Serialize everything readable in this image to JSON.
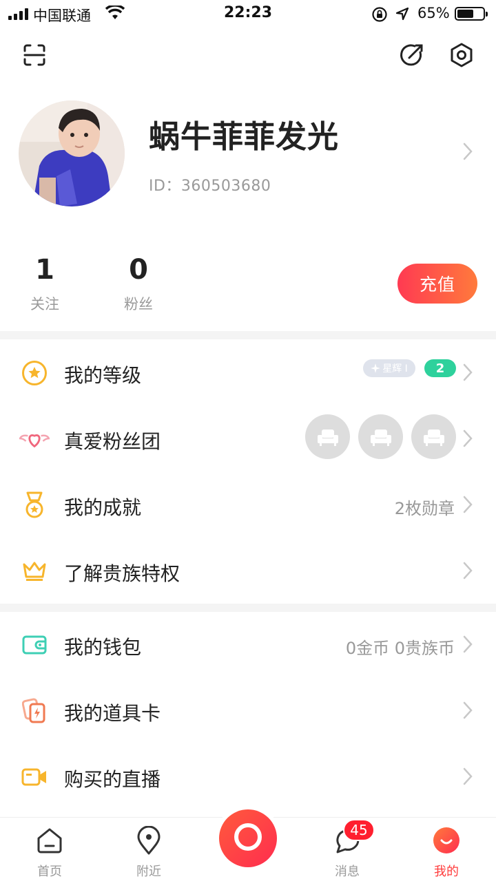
{
  "status_bar": {
    "carrier": "中国联通",
    "time": "22:23",
    "battery_percent": "65%",
    "battery_level": 0.65
  },
  "toolbar": {
    "scan_icon": "scan-icon",
    "edit_icon": "edit-icon",
    "settings_icon": "settings-icon"
  },
  "profile": {
    "nickname": "蜗牛菲菲发光",
    "id": "ID：360503680"
  },
  "stats": {
    "following_count": "1",
    "following_label": "关注",
    "fans_count": "0",
    "fans_label": "粉丝",
    "recharge_label": "充值"
  },
  "menu": {
    "level": {
      "label": "我的等级",
      "badge_rank": "星辉 I",
      "badge_level": "2",
      "icon": "star-icon"
    },
    "fan_club": {
      "label": "真爱粉丝团",
      "icon": "heart-wings-icon"
    },
    "achievements": {
      "label": "我的成就",
      "value": "2枚勋章",
      "icon": "medal-icon"
    },
    "nobility": {
      "label": "了解贵族特权",
      "icon": "crown-icon"
    },
    "wallet": {
      "label": "我的钱包",
      "value": "0金币 0贵族币",
      "icon": "wallet-icon"
    },
    "prop_cards": {
      "label": "我的道具卡",
      "icon": "card-icon"
    },
    "purchased_live": {
      "label": "购买的直播",
      "icon": "video-camera-icon"
    }
  },
  "tabbar": {
    "home": "首页",
    "nearby": "附近",
    "messages": "消息",
    "messages_badge": "45",
    "mine": "我的"
  },
  "colors": {
    "accent_red": "#ff3b3b",
    "recharge_gradient_start": "#ff3a52",
    "recharge_gradient_end": "#ff7a3c",
    "level_badge": "#2ed19c"
  }
}
